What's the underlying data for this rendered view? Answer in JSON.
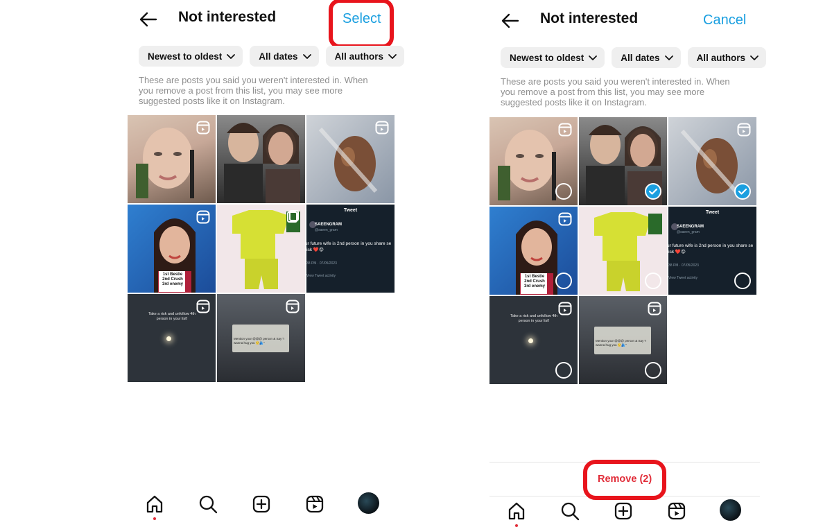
{
  "left": {
    "title": "Not interested",
    "action_label": "Select",
    "filters": [
      "Newest to oldest",
      "All dates",
      "All authors"
    ],
    "description": "These are posts you said you weren't interested in. When you remove a post from this list, you may see more suggested posts like it on Instagram."
  },
  "right": {
    "title": "Not interested",
    "action_label": "Cancel",
    "filters": [
      "Newest to oldest",
      "All dates",
      "All authors"
    ],
    "description": "These are posts you said you weren't interested in. When you remove a post from this list, you may see more suggested posts like it on Instagram.",
    "remove_label": "Remove (2)"
  },
  "tiles": {
    "t1_caption": "",
    "t4_caption": "1st Bestie\n2nd Crush\n3rd enemy",
    "t6_header": "Tweet",
    "t6_user": "SAEENGRAM",
    "t6_handle": "@saeen_gram",
    "t6_text": "ur future wife is 2nd person in you share se risk ❤️😝",
    "t6_time": "38 PM · 07/05/2023",
    "t6_activity": "View Tweet activity",
    "t7_text": "Take a risk and unfollow 4th person in your list!",
    "t8_text": "Mention your @@@ person & Say \"I wanna hug you 🥺🫂\""
  },
  "icons": {
    "back": "arrow-left-icon",
    "chevron": "chevron-down-icon",
    "reel": "reel-icon",
    "home": "home-icon",
    "search": "search-icon",
    "create": "plus-square-icon",
    "reels": "reels-icon",
    "profile": "profile-avatar"
  },
  "colors": {
    "accent": "#1a9fe0",
    "remove": "#e12d39",
    "highlight": "#e8141c"
  }
}
